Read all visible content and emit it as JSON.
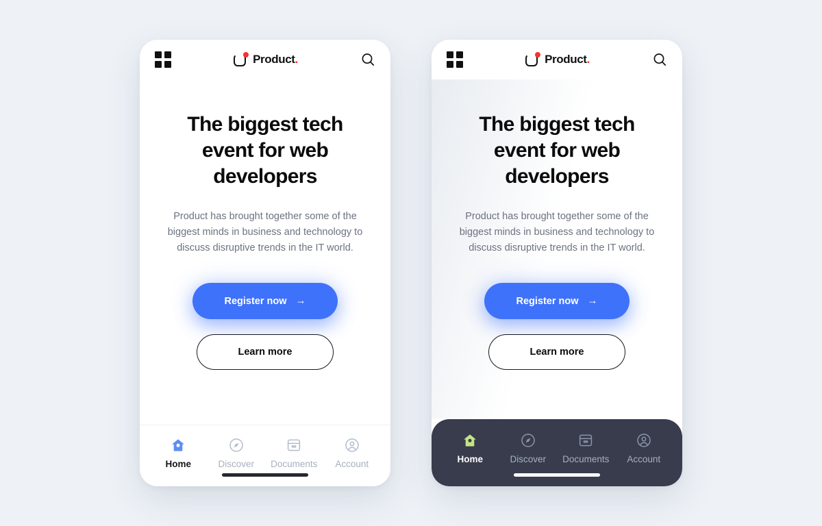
{
  "page": {
    "background_color": "#eef2f7"
  },
  "colors": {
    "accent_blue": "#3f72fa",
    "brand_red": "#f8312f",
    "dark_navbar": "#383c4d",
    "active_green": "#c5e384",
    "muted_text": "#6b7280",
    "tab_inactive": "#a7b0be"
  },
  "phones": [
    {
      "variant": "light-navbar",
      "header": {
        "menu_icon": "grid-menu-icon",
        "brand": {
          "mark_icon": "product-logo-mark-icon",
          "name": "Product",
          "period": "."
        },
        "search_icon": "search-icon"
      },
      "hero": {
        "headline": "The biggest tech event for web developers",
        "subcopy": "Product has brought together some of the biggest minds in business and technology to discuss disruptive trends in the IT world.",
        "primary_button": {
          "label": "Register now",
          "arrow": "→"
        },
        "secondary_button": {
          "label": "Learn more"
        }
      },
      "tabbar": {
        "style": "light",
        "items": [
          {
            "label": "Home",
            "icon": "home-icon",
            "active": true
          },
          {
            "label": "Discover",
            "icon": "compass-icon",
            "active": false
          },
          {
            "label": "Documents",
            "icon": "archive-box-icon",
            "active": false
          },
          {
            "label": "Account",
            "icon": "account-circle-icon",
            "active": false
          }
        ]
      }
    },
    {
      "variant": "dark-navbar",
      "header": {
        "menu_icon": "grid-menu-icon",
        "brand": {
          "mark_icon": "product-logo-mark-icon",
          "name": "Product",
          "period": "."
        },
        "search_icon": "search-icon"
      },
      "hero": {
        "headline": "The biggest tech event for web developers",
        "subcopy": "Product has brought together some of the biggest minds in business and technology to discuss disruptive trends in the IT world.",
        "primary_button": {
          "label": "Register now",
          "arrow": "→"
        },
        "secondary_button": {
          "label": "Learn more"
        }
      },
      "tabbar": {
        "style": "dark",
        "items": [
          {
            "label": "Home",
            "icon": "home-icon",
            "active": true
          },
          {
            "label": "Discover",
            "icon": "compass-icon",
            "active": false
          },
          {
            "label": "Documents",
            "icon": "archive-box-icon",
            "active": false
          },
          {
            "label": "Account",
            "icon": "account-circle-icon",
            "active": false
          }
        ]
      }
    }
  ]
}
